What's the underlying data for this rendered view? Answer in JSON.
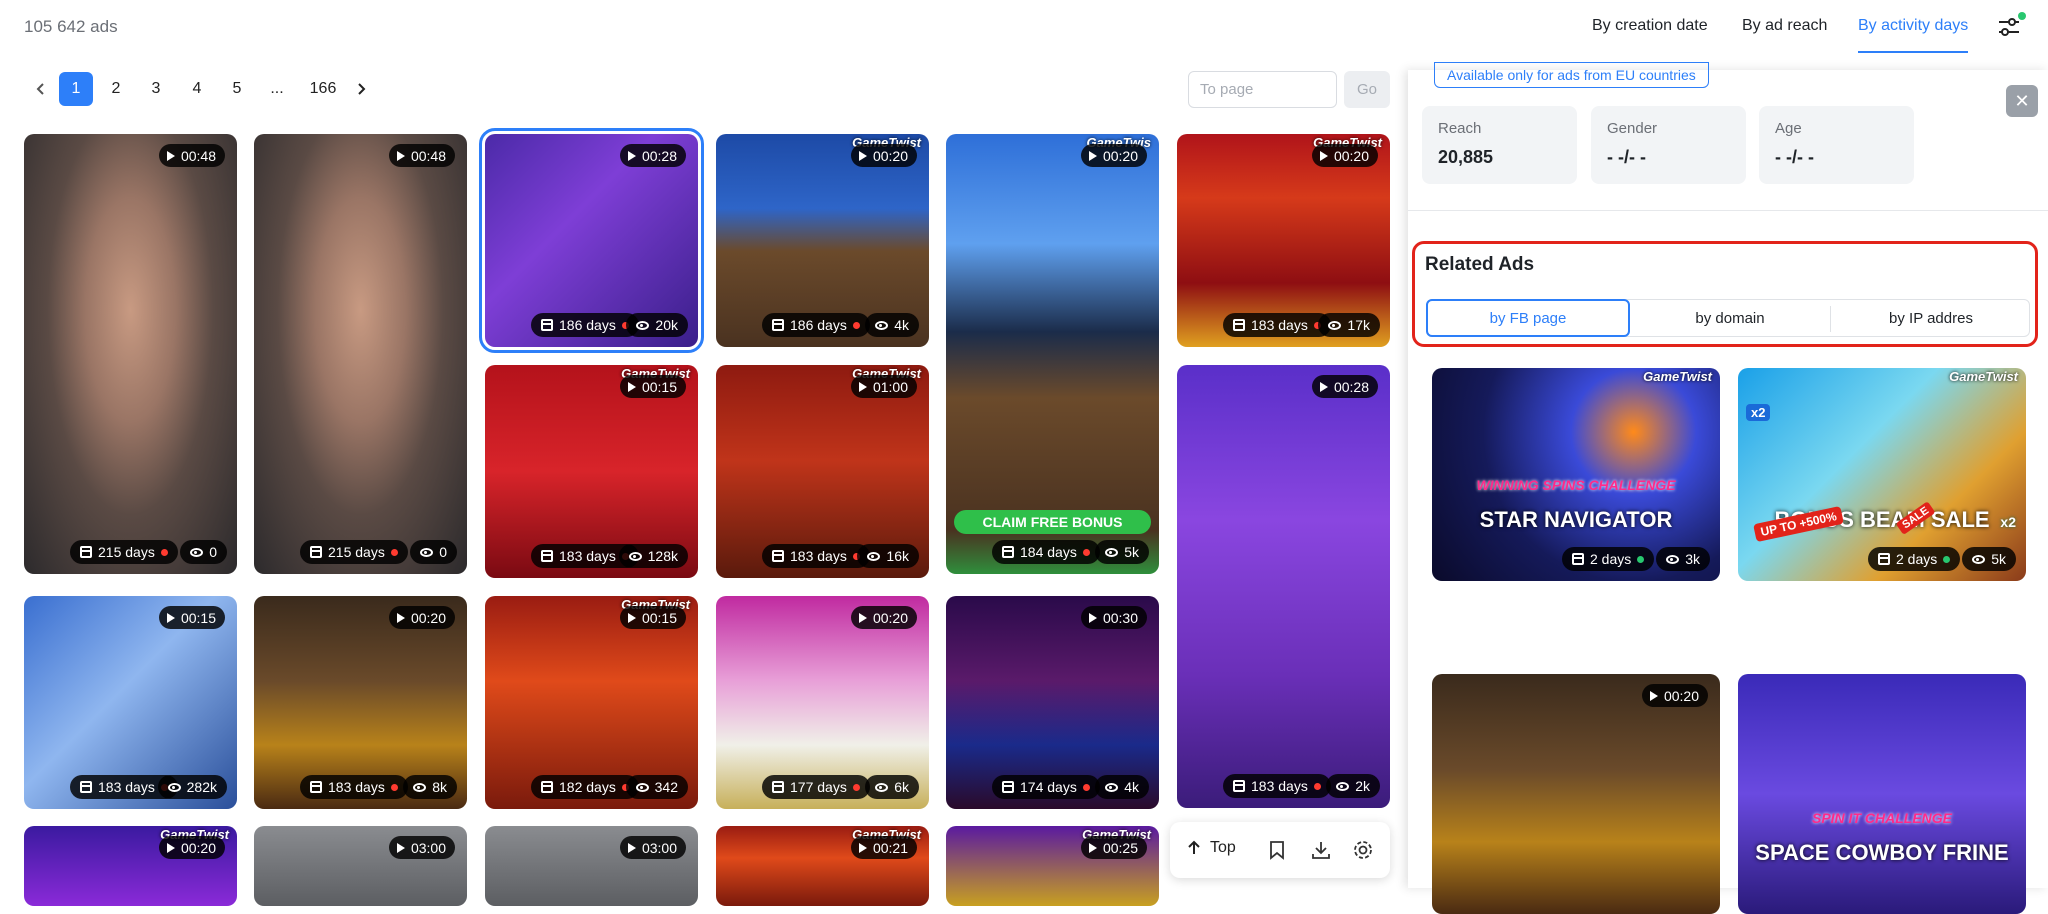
{
  "header": {
    "ads_count": "105 642 ads",
    "sort_tabs": [
      "By creation date",
      "By ad reach",
      "By activity days"
    ],
    "active_sort": "By activity days",
    "filter_icon": "sliders-icon",
    "accent": "#2d7ff9"
  },
  "pagination": {
    "prev_icon": "chevron-left-icon",
    "pages": [
      "1",
      "2",
      "3",
      "4",
      "5",
      "...",
      "166"
    ],
    "active_page": "1",
    "next_icon": "chevron-right-icon",
    "to_page_placeholder": "To page",
    "go_label": "Go"
  },
  "ads": [
    {
      "duration": "00:48",
      "days": "215 days",
      "views": "0",
      "status_color": "#ff3b30",
      "theme": "woman"
    },
    {
      "duration": "00:48",
      "days": "215 days",
      "views": "0",
      "status_color": "#ff3b30",
      "theme": "woman"
    },
    {
      "duration": "00:28",
      "days": "186 days",
      "views": "20k",
      "status_color": "#ff3b30",
      "theme": "purple",
      "selected": true
    },
    {
      "duration": "00:20",
      "days": "186 days",
      "views": "4k",
      "status_color": "#ff3b30",
      "theme": "faust",
      "brand": "GameTwist"
    },
    {
      "duration": "00:20",
      "days": "184 days",
      "views": "5k",
      "status_color": "#ff3b30",
      "theme": "faust-tall",
      "brand": "GameTwis",
      "cta": "CLAIM FREE BONUS"
    },
    {
      "duration": "00:20",
      "days": "183 days",
      "views": "17k",
      "status_color": "#ff3b30",
      "theme": "red-fruit",
      "brand": "GameTwist"
    },
    {
      "duration": "00:15",
      "days": "183 days",
      "views": "128k",
      "status_color": "#ff3b30",
      "theme": "red-slot",
      "brand": "GameTwist"
    },
    {
      "duration": "01:00",
      "days": "183 days",
      "views": "16k",
      "status_color": "#ff3b30",
      "theme": "book",
      "brand": "GameTwist"
    },
    {
      "duration": "00:28",
      "days": "183 days",
      "views": "2k",
      "status_color": "#ff3b30",
      "theme": "purple-tall"
    },
    {
      "duration": "00:15",
      "days": "183 days",
      "views": "282k",
      "status_color": "#ff3b30",
      "theme": "blue"
    },
    {
      "duration": "00:20",
      "days": "183 days",
      "views": "8k",
      "status_color": "#ff3b30",
      "theme": "explorer"
    },
    {
      "duration": "00:15",
      "days": "182 days",
      "views": "342",
      "status_color": "#ff3b30",
      "theme": "book-red",
      "brand": "GameTwist"
    },
    {
      "duration": "00:20",
      "days": "177 days",
      "views": "6k",
      "status_color": "#ff3b30",
      "theme": "lucky"
    },
    {
      "duration": "00:30",
      "days": "174 days",
      "views": "4k",
      "status_color": "#ff3b30",
      "theme": "megawin"
    },
    {
      "duration": "00:20",
      "theme": "diamond",
      "brand": "GameTwist"
    },
    {
      "duration": "03:00",
      "theme": "gray"
    },
    {
      "duration": "03:00",
      "theme": "gray"
    },
    {
      "duration": "00:21",
      "theme": "book-red",
      "brand": "GameTwist"
    },
    {
      "duration": "00:25",
      "theme": "wheel",
      "brand": "GameTwist"
    }
  ],
  "floating_bar": {
    "top_label": "Top",
    "icons": [
      "arrow-up-icon",
      "bookmark-icon",
      "download-icon",
      "settings-icon"
    ]
  },
  "panel": {
    "eu_note": "Available only for ads from EU countries",
    "close_icon": "close-icon",
    "reach_label": "Reach",
    "reach_value": "20,885",
    "gender_label": "Gender",
    "gender_value": "- -/- -",
    "age_label": "Age",
    "age_value": "- -/- -",
    "related_title": "Related Ads",
    "related_tabs": [
      "by FB page",
      "by domain",
      "by IP addres"
    ],
    "related_active": "by FB page",
    "highlight_color": "#e2231a",
    "related_ads": [
      {
        "days": "2 days",
        "views": "3k",
        "status_color": "#28c76f",
        "theme": "space",
        "title": "STAR NAVIGATOR",
        "badge": "WINNING SPINS CHALLENGE",
        "brand": "GameTwist"
      },
      {
        "days": "2 days",
        "views": "5k",
        "status_color": "#28c76f",
        "theme": "bonus",
        "title": "BONUS BEAM SALE",
        "badge_top": "x2",
        "badge_side": "x2",
        "offer": "UP TO +500%",
        "tag": "SALE",
        "brand": "GameTwist"
      },
      {
        "duration": "00:20",
        "theme": "explorer"
      },
      {
        "theme": "cowboy",
        "title": "SPACE COWBOY FRINE",
        "badge": "SPIN IT CHALLENGE"
      }
    ]
  }
}
